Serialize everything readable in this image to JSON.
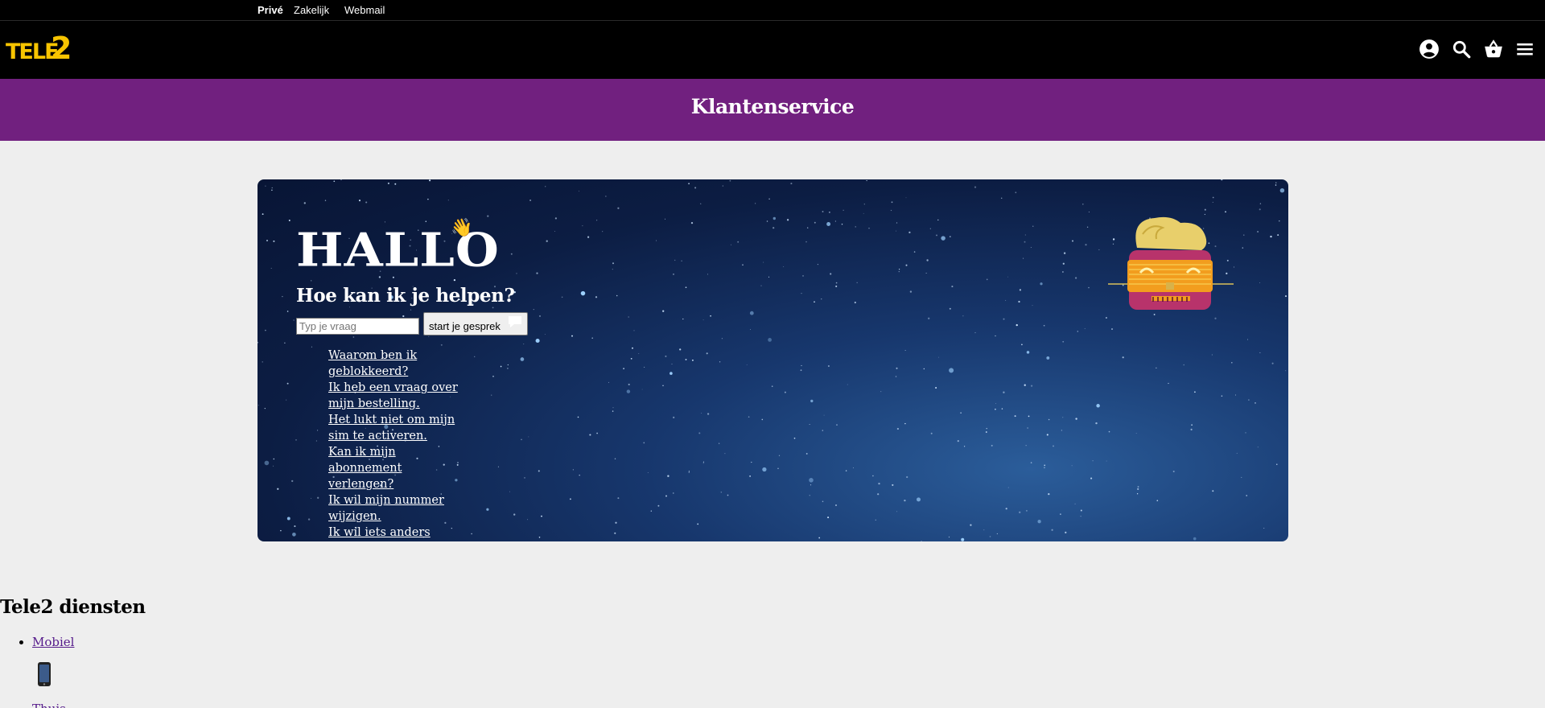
{
  "utility_nav": [
    {
      "label": "Privé",
      "active": true
    },
    {
      "label": "Zakelijk",
      "active": false
    },
    {
      "label": "Webmail",
      "active": false
    }
  ],
  "header": {
    "logo_text": "TELE2",
    "icons": [
      "account-icon",
      "search-icon",
      "basket-icon",
      "menu-icon"
    ]
  },
  "banner": {
    "title": "Klantenservice"
  },
  "hero": {
    "greeting": "HALLO",
    "greeting_emoji": "👋",
    "subtitle": "Hoe kan ik je helpen?",
    "input_placeholder": "Typ je vraag",
    "start_button": "start je gesprek",
    "suggestions": [
      "Waarom ben ik geblokkeerd?",
      "Ik heb een vraag over mijn bestelling.",
      "Het lukt niet om mijn sim te activeren.",
      "Kan ik mijn abonnement verlengen?",
      "Ik wil mijn nummer wijzigen.",
      "Ik wil iets anders vragen"
    ]
  },
  "services": {
    "title": "Tele2 diensten",
    "items": [
      {
        "label": "Mobiel",
        "icon": "mobile-phone-icon"
      },
      {
        "label": "Thuis"
      }
    ]
  },
  "colors": {
    "header_bg": "#000000",
    "logo_yellow": "#f7c400",
    "banner_purple": "#71207f",
    "page_bg": "#eeeeee",
    "hero_navy": "#0c1d43"
  }
}
